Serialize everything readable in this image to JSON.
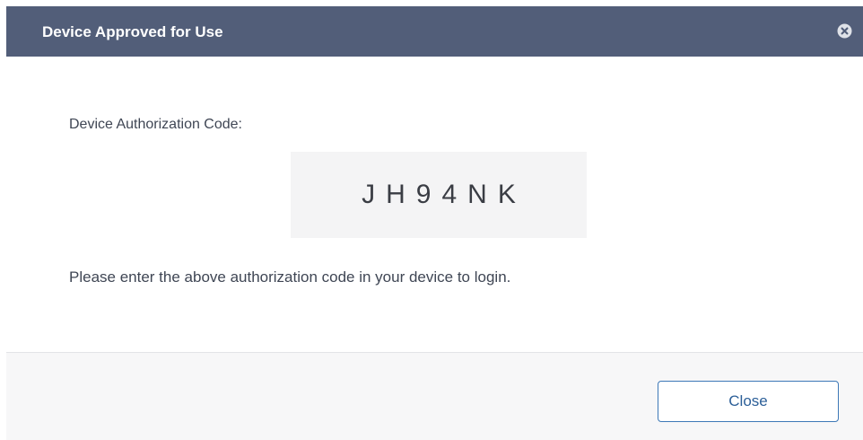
{
  "dialog": {
    "title": "Device Approved for Use",
    "close_icon": "close-circle-icon",
    "code_label": "Device Authorization Code:",
    "code_value": "JH94NK",
    "instructions": "Please enter the above authorization code in your device to login.",
    "close_button_label": "Close"
  },
  "colors": {
    "header_bg": "#525e79",
    "header_text": "#ffffff",
    "code_box_bg": "#f4f4f5",
    "footer_bg": "#f7f7f8",
    "button_border": "#3d78b7",
    "button_text": "#2c5f98"
  }
}
